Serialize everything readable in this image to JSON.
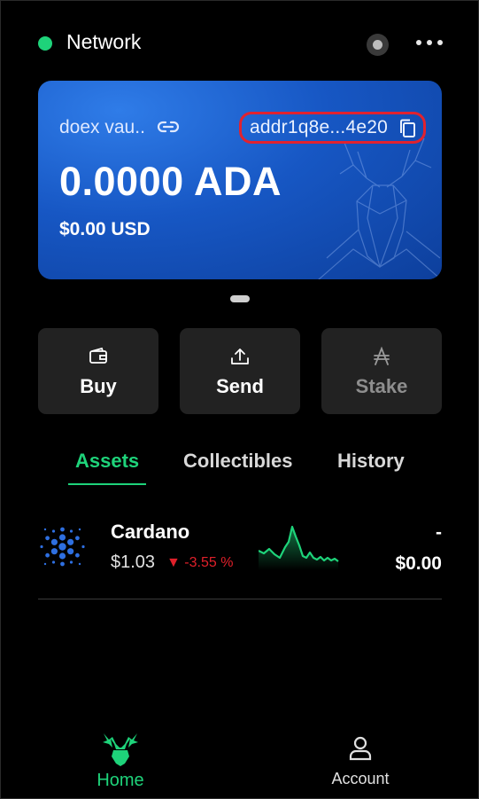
{
  "header": {
    "network_label": "Network",
    "network_status_color": "#1ed37a",
    "status_icon": "status-indicator-icon",
    "more_icon": "more-horizontal-icon"
  },
  "card": {
    "wallet_name": "doex vau..",
    "link_icon": "link-icon",
    "address": "addr1q8e...4e20",
    "copy_icon": "copy-icon",
    "balance": "0.0000 ADA",
    "fiat_balance": "$0.00 USD",
    "highlight_color": "#e1222f"
  },
  "actions": {
    "buy_label": "Buy",
    "send_label": "Send",
    "stake_label": "Stake"
  },
  "tabs": {
    "assets": "Assets",
    "collectibles": "Collectibles",
    "history": "History",
    "active": "Assets",
    "accent_color": "#1ed37a"
  },
  "assets": [
    {
      "name": "Cardano",
      "price": "$1.03",
      "change": "-3.55 %",
      "change_direction": "down",
      "quantity": "-",
      "value": "$0.00",
      "icon": "cardano-logo-icon"
    }
  ],
  "nav": {
    "home_label": "Home",
    "account_label": "Account",
    "active": "Home"
  }
}
